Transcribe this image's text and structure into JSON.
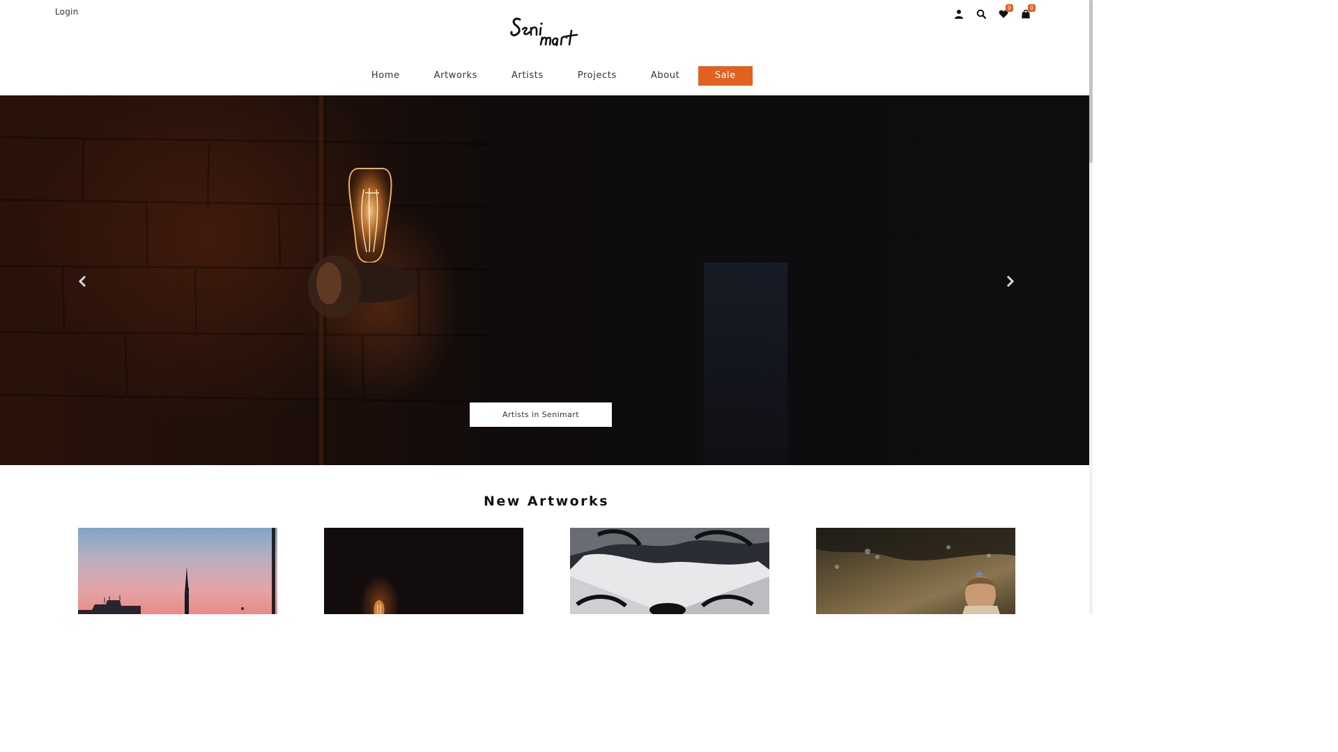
{
  "header": {
    "login_label": "Login",
    "logo_alt": "Senimart",
    "wishlist_count": "0",
    "cart_count": "0",
    "icons": [
      "user-icon",
      "search-icon",
      "heart-icon",
      "cart-icon"
    ]
  },
  "nav": {
    "items": [
      "Home",
      "Artworks",
      "Artists",
      "Projects",
      "About"
    ],
    "sale_label": "Sale"
  },
  "hero": {
    "cta_label": "Artists in Senimart"
  },
  "new_artworks": {
    "title": "New Artworks"
  },
  "colors": {
    "accent": "#e1611e",
    "text": "#333333"
  }
}
